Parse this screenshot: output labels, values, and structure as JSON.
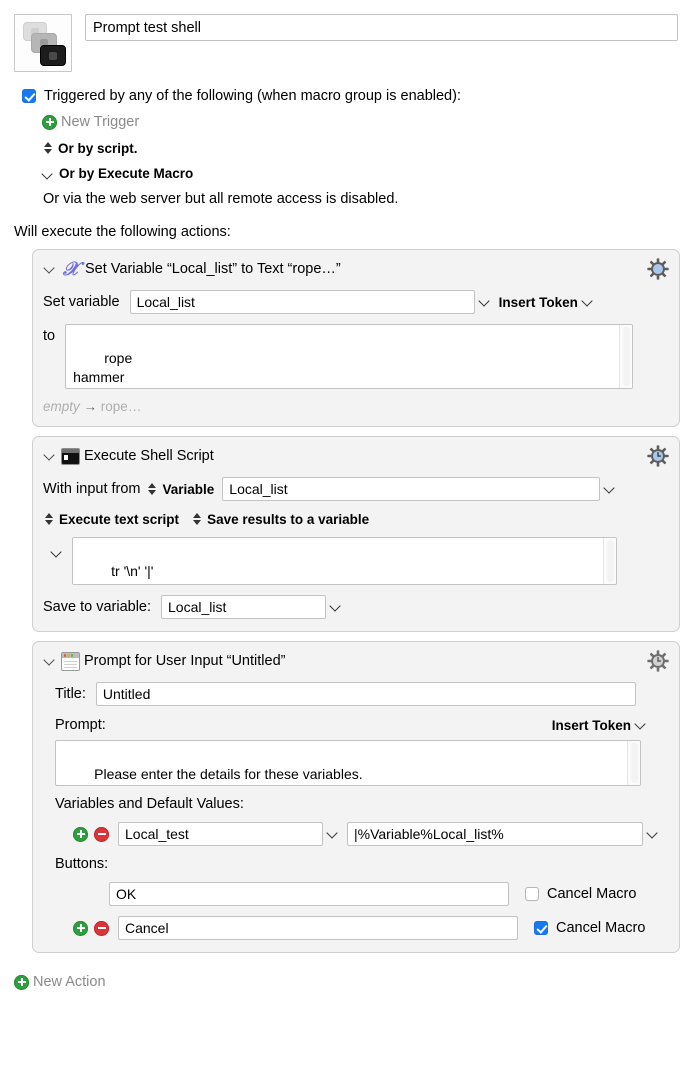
{
  "macro": {
    "icon_name": "macro-keys-icon",
    "title_value": "Prompt test shell"
  },
  "trigger": {
    "checkbox_checked": true,
    "label": "Triggered by any of the following (when macro group is enabled):",
    "new_trigger_label": "New Trigger",
    "or_by_script": "Or by script.",
    "or_by_execute_macro": "Or by Execute Macro",
    "web_server_note": "Or via the web server but all remote access is disabled."
  },
  "actions_header": "Will execute the following actions:",
  "actions": [
    {
      "icon": "set-variable-x-icon",
      "title": "Set Variable “Local_list” to Text “rope…”",
      "gear": "gear-icon",
      "set_variable_label": "Set variable",
      "variable_name": "Local_list",
      "insert_token_label": "Insert Token",
      "to_label": "to",
      "text_value": "rope\nhammer\nscrewdriver",
      "footer_before": "empty",
      "footer_arrow": "→",
      "footer_after": "rope…"
    },
    {
      "icon": "terminal-icon",
      "title": "Execute Shell Script",
      "gear": "gear-clock-icon",
      "with_input_from_label": "With input from",
      "input_source": "Variable",
      "input_variable": "Local_list",
      "execute_mode": "Execute text script",
      "save_mode": "Save results to a variable",
      "script_value": "tr '\\n' '|'",
      "save_to_variable_label": "Save to variable:",
      "save_to_variable": "Local_list"
    },
    {
      "icon": "prompt-window-icon",
      "title": "Prompt for User Input “Untitled”",
      "gear": "gear-clock-icon",
      "title_label": "Title:",
      "title_value": "Untitled",
      "prompt_label": "Prompt:",
      "insert_token_label": "Insert Token",
      "prompt_value": "Please enter the details for these variables.",
      "variables_label": "Variables and Default Values:",
      "variables": [
        {
          "name": "Local_test",
          "value": "|%Variable%Local_list%"
        }
      ],
      "buttons_label": "Buttons:",
      "buttons": [
        {
          "label": "OK",
          "cancel_macro": false,
          "cancel_macro_label": "Cancel Macro",
          "has_addremove": false
        },
        {
          "label": "Cancel",
          "cancel_macro": true,
          "cancel_macro_label": "Cancel Macro",
          "has_addremove": true
        }
      ]
    }
  ],
  "new_action_label": "New Action",
  "colors": {
    "accent_blue": "#1778f2",
    "add_green": "#2f9e3f",
    "remove_red": "#d9353a",
    "variable_purple": "#6f6fe0",
    "card_bg": "#f3f3f3",
    "card_border": "#cfcfcf"
  }
}
